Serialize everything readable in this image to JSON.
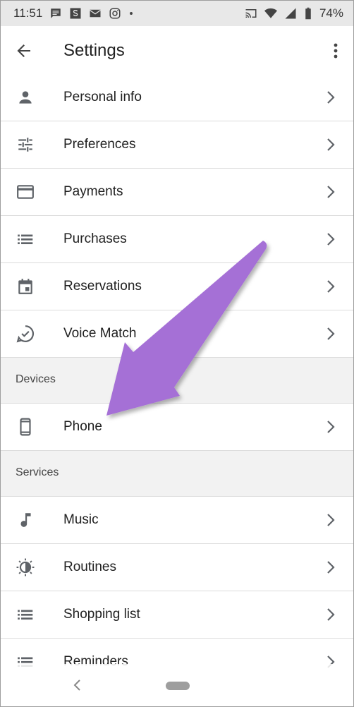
{
  "status_bar": {
    "time": "11:51",
    "battery": "74%"
  },
  "app_bar": {
    "title": "Settings"
  },
  "list": [
    {
      "type": "item",
      "label": "Personal info",
      "icon": "person-icon"
    },
    {
      "type": "item",
      "label": "Preferences",
      "icon": "tune-icon"
    },
    {
      "type": "item",
      "label": "Payments",
      "icon": "credit-card-icon"
    },
    {
      "type": "item",
      "label": "Purchases",
      "icon": "list-icon"
    },
    {
      "type": "item",
      "label": "Reservations",
      "icon": "calendar-icon"
    },
    {
      "type": "item",
      "label": "Voice Match",
      "icon": "voice-match-icon"
    },
    {
      "type": "section",
      "label": "Devices"
    },
    {
      "type": "item",
      "label": "Phone",
      "icon": "phone-icon"
    },
    {
      "type": "section",
      "label": "Services"
    },
    {
      "type": "item",
      "label": "Music",
      "icon": "music-note-icon"
    },
    {
      "type": "item",
      "label": "Routines",
      "icon": "routines-icon"
    },
    {
      "type": "item",
      "label": "Shopping list",
      "icon": "list-icon"
    },
    {
      "type": "item",
      "label": "Reminders",
      "icon": "list-icon"
    }
  ],
  "colors": {
    "arrow": "#a56fd6",
    "icon": "#5f6368",
    "section_bg": "#f2f2f2",
    "status_bg": "#e8e8e8"
  }
}
